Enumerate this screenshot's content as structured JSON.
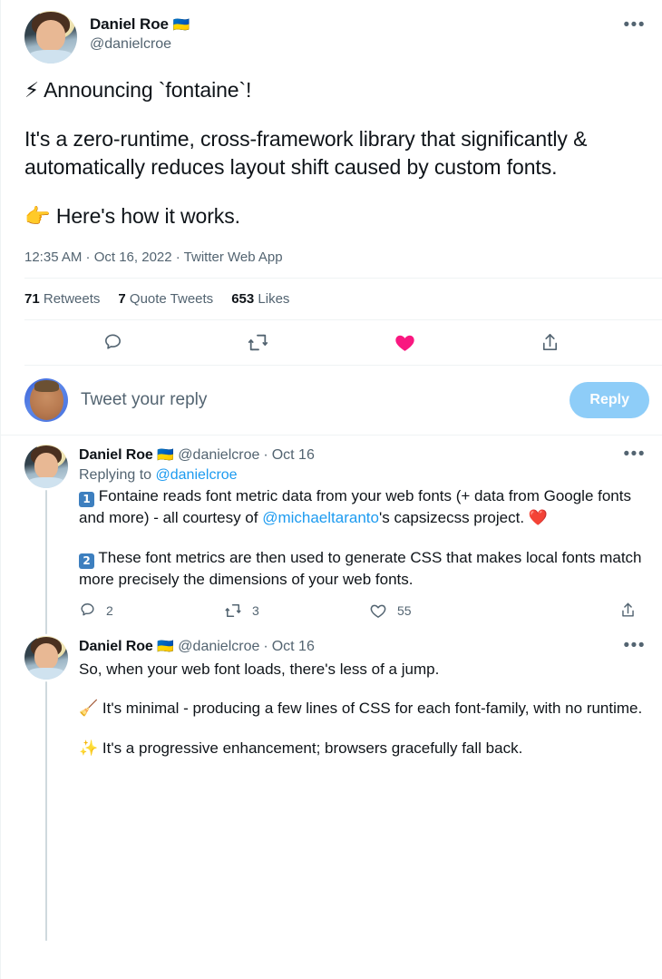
{
  "colors": {
    "accent": "#1d9bf0",
    "like_filled": "#f91880",
    "text": "#0f1419",
    "muted": "#536471",
    "divider": "#eff3f4",
    "reply_button": "#8ecdf8",
    "thread_line": "#cfd9de"
  },
  "main_tweet": {
    "author_name": "Daniel Roe",
    "author_flag": "🇺🇦",
    "handle": "@danielcroe",
    "more_label": "•••",
    "body_line1": "⚡ Announcing `fontaine`!",
    "body_line2": "It's a zero-runtime, cross-framework library that significantly & automatically reduces layout shift caused by custom fonts.",
    "body_line3": "👉 Here's how it works.",
    "timestamp": "12:35 AM · Oct 16, 2022 · Twitter Web App",
    "stats": {
      "retweets_count": "71",
      "retweets_label": "Retweets",
      "quotes_count": "7",
      "quotes_label": "Quote Tweets",
      "likes_count": "653",
      "likes_label": "Likes"
    },
    "actions": {
      "reply_icon": "reply-icon",
      "retweet_icon": "retweet-icon",
      "like_icon": "like-icon-filled",
      "share_icon": "share-icon"
    }
  },
  "composer": {
    "placeholder": "Tweet your reply",
    "reply_button_label": "Reply"
  },
  "replies": [
    {
      "author_name": "Daniel Roe",
      "author_flag": "🇺🇦",
      "handle": "@danielcroe",
      "separator": "·",
      "date": "Oct 16",
      "more_label": "•••",
      "replying_prefix": "Replying to ",
      "replying_to": "@danielcroe",
      "para1_badge": "1",
      "para1_a": " Fontaine reads font metric data from your web fonts (+ data from Google fonts and more) - all courtesy of ",
      "para1_mention": "@michaeltaranto",
      "para1_b": "'s capsizecss project. ❤️",
      "para2_badge": "2",
      "para2": " These font metrics are then used to generate CSS that makes local fonts match more precisely the dimensions of your web fonts.",
      "metrics": {
        "replies": "2",
        "retweets": "3",
        "likes": "55"
      }
    },
    {
      "author_name": "Daniel Roe",
      "author_flag": "🇺🇦",
      "handle": "@danielcroe",
      "separator": "·",
      "date": "Oct 16",
      "more_label": "•••",
      "para1": "So, when your web font loads, there's less of a jump.",
      "para2": "🧹 It's minimal - producing a few lines of CSS for each font-family, with no runtime.",
      "para3": "✨ It's a progressive enhancement; browsers gracefully fall back."
    }
  ]
}
